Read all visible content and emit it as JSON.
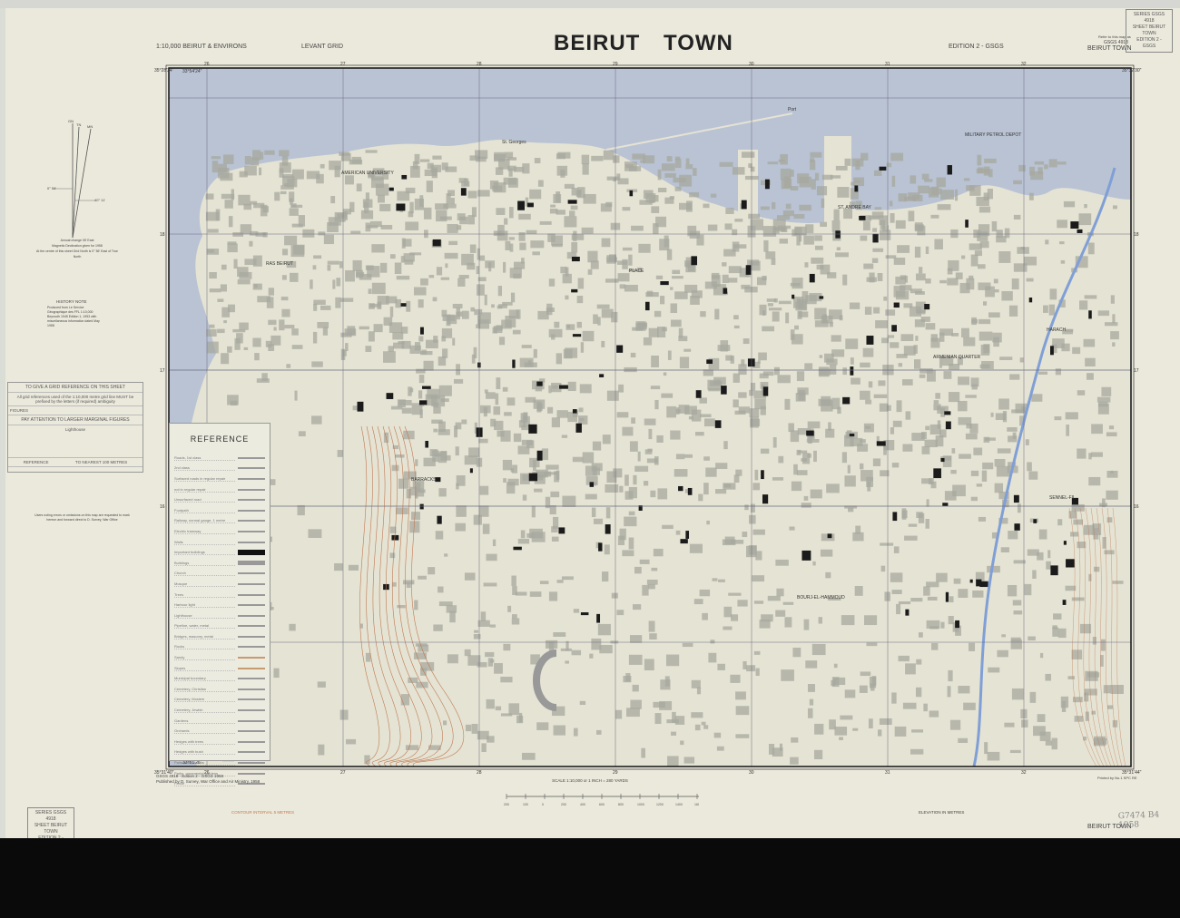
{
  "header": {
    "scale_series": "1:10,000 BEIRUT & ENVIRONS",
    "grid": "LEVANT GRID",
    "title": "BEIRUT TOWN",
    "edition": "EDITION 2 - GSGS",
    "sheet": "BEIRUT TOWN",
    "refer_note": "Refer to this map as",
    "refer_code": "GSGS 4918"
  },
  "sheet_box": {
    "line1": "SERIES GSGS 4918",
    "line2": "SHEET BEIRUT TOWN",
    "line3": "EDITION 2 - GSGS"
  },
  "grid": {
    "eastings": [
      "26",
      "27",
      "28",
      "29",
      "30",
      "31",
      "32"
    ],
    "northings": [
      "18",
      "17",
      "16"
    ],
    "corner_nw": "35°28'24\"",
    "corner_ne": "35°32'30\"",
    "corner_sw": "35°31'40\"",
    "corner_se": "35°31'44\"",
    "lat_top": "33°54'24\"",
    "lat_bottom": "33°51'26\""
  },
  "north_arrow": {
    "gn": "GN",
    "tn": "TN",
    "mn": "MN",
    "angle1": "0° 56'",
    "angle2": "40° 11'",
    "note1": "Annual change 05' East",
    "note2": "Magnetic Declination given for 1958",
    "note3": "At the centre of this sheet Grid North is 0° 56' East of True North"
  },
  "history": {
    "title": "HISTORY NOTE",
    "text": "Produced from Le Service Géographique des FFL 1:10,000 Beyrouth 1945 Edition 1, 1953 with miscellaneous information dated May 1958"
  },
  "grid_reference": {
    "title": "TO GIVE A GRID REFERENCE ON THIS SHEET",
    "must": "All grid references used of the 1:10,000 metre grid line MUST be prefixed by the letters (if required) ambiguity",
    "figures": "FIGURES",
    "attention": "PAY ATTENTION TO LARGER MARGINAL FIGURES",
    "example": "Lighthouse",
    "reference": "REFERENCE",
    "nearest": "TO NEAREST 100 METRES"
  },
  "errors_note": "Users noting errors or omissions on this map are requested to mark hereon and forward direct to D. Survey, War Office",
  "map_labels": [
    "AMERICAN UNIVERSITY",
    "RAS BEIRUT",
    "PLACE",
    "ST. ANDRÉ BAY",
    "ARMENIAN QUARTER",
    "HARACH",
    "SENNEL-FIL",
    "BOURJ-EL-HAMMOUD",
    "BARRACKS",
    "Port",
    "St. Georges",
    "MILITARY PETROL DEPOT"
  ],
  "reference": {
    "title": "REFERENCE",
    "items": [
      "Roads, 1st class",
      "2nd class",
      "Surfaced roads in regular repair",
      "not in regular repair",
      "Unsurfaced road",
      "Footpath",
      "Railway, normal gauge, 1 metre",
      "Electric tramway",
      "Walls",
      "Important buildings",
      "Buildings",
      "Church",
      "Mosque",
      "Trees",
      "Harbour light",
      "Lighthouse",
      "Pipeline, water, metal",
      "Bridges, masonry, metal",
      "Rocks",
      "Sandy",
      "Slopes",
      "Municipal boundary",
      "Cemetery, Christian",
      "Cemetery, Moslem",
      "Cemetery, Jewish",
      "Gardens",
      "Orchards",
      "Hedges with trees",
      "Hedges with bush",
      "Palm trees, cactus",
      "Parks, ornamental gardens",
      "Fence"
    ]
  },
  "footer": {
    "edition": "GSGS 4918 - Edition 2 - GSGS 1958",
    "published": "Published by D. Survey, War Office and Air Ministry, 1958",
    "scale": "SCALE 1:10,000 or 1 INCH = 280 YARDS",
    "yards_ticks": [
      "200",
      "100",
      "0",
      "200",
      "400",
      "600",
      "800",
      "1000",
      "1200",
      "1400",
      "1600"
    ],
    "contour": "CONTOUR INTERVAL 5 METRES",
    "elevation": "ELEVATION IN METRES",
    "printed": "Printed by No.1 SPC RE",
    "sheet": "BEIRUT TOWN",
    "handwritten": "G7474 B4 1958"
  },
  "colors": {
    "sea": "#b9c3d4",
    "land": "#e5e3d3",
    "urban": "#a7a89f",
    "building": "#1b1b1b",
    "contour": "#c07a55",
    "river": "#7f9fd6"
  }
}
